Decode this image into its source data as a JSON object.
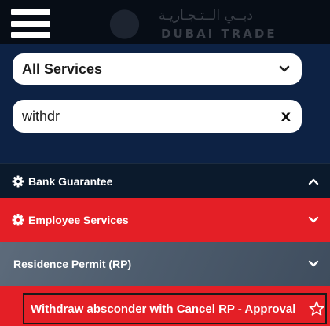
{
  "header": {
    "logo_ar": "دبــي الــتـجـاريـة",
    "logo_en": "DUBAI TRADE"
  },
  "search": {
    "category_value": "All Services",
    "query_value": "withdr",
    "clear_label": "x"
  },
  "menu": {
    "bank_guarantee": {
      "label": "Bank Guarantee",
      "icon": "gear-icon",
      "state": "collapsed-up"
    },
    "employee_services": {
      "label": "Employee Services",
      "icon": "gear-icon",
      "state": "expanded"
    },
    "residence_permit": {
      "label": "Residence Permit (RP)",
      "state": "expanded"
    },
    "service_item": {
      "label": "Withdraw absconder with Cancel RP - Approval",
      "icon": "star-icon"
    }
  },
  "colors": {
    "navy": "#0d2244",
    "red": "#e41f26",
    "slate": "#4d5c6d"
  }
}
